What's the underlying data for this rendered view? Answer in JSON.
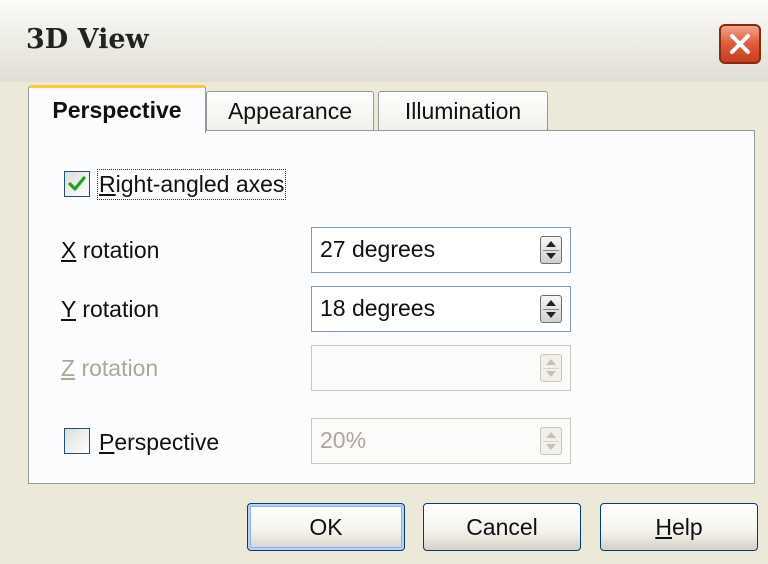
{
  "window": {
    "title": "3D View",
    "close_icon": "close-x-icon"
  },
  "tabs": [
    {
      "label": "Perspective",
      "active": true
    },
    {
      "label": "Appearance",
      "active": false
    },
    {
      "label": "Illumination",
      "active": false
    }
  ],
  "perspective_tab": {
    "right_angled_axes": {
      "label_mnemonic": "R",
      "label_rest": "ight-angled axes",
      "checked": true
    },
    "x_rotation": {
      "label_mnemonic": "X",
      "label_rest": " rotation",
      "value": "27 degrees"
    },
    "y_rotation": {
      "label_mnemonic": "Y",
      "label_rest": " rotation",
      "value": "18 degrees"
    },
    "z_rotation": {
      "label_mnemonic": "Z",
      "label_rest": " rotation",
      "value": "",
      "disabled": true
    },
    "perspective": {
      "label_mnemonic": "P",
      "label_rest": "erspective",
      "checked": false,
      "value": "20%",
      "value_disabled": true
    }
  },
  "buttons": {
    "ok": "OK",
    "cancel": "Cancel",
    "help_mnemonic": "H",
    "help_rest": "elp"
  },
  "colors": {
    "accent_tab": "#ffc83c",
    "close_button": "#e1603e",
    "check_mark": "#21a121"
  }
}
